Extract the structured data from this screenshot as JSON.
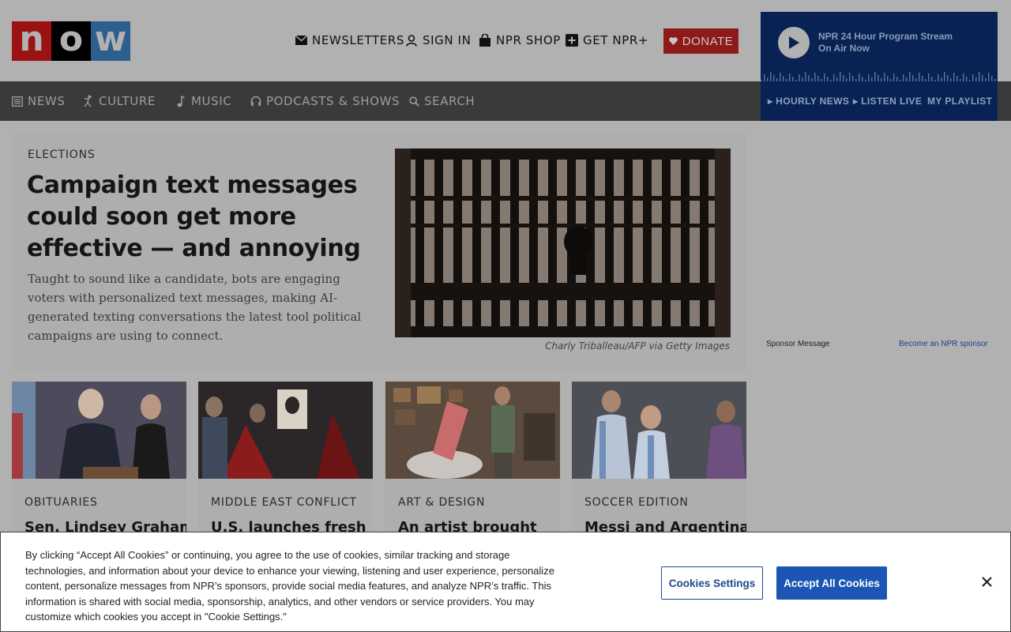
{
  "logo": {
    "letters": [
      "n",
      "o",
      "w"
    ]
  },
  "utility": {
    "newsletters": "NEWSLETTERS",
    "sign_in": "SIGN IN",
    "shop": "NPR SHOP",
    "plus": "GET NPR+"
  },
  "donate": "DONATE",
  "player": {
    "title": "NPR 24 Hour Program Stream",
    "subtitle": "On Air Now",
    "hourly": "▸ HOURLY NEWS",
    "live": "▸ LISTEN LIVE",
    "playlist": "MY PLAYLIST"
  },
  "nav": {
    "news": "NEWS",
    "culture": "CULTURE",
    "music": "MUSIC",
    "podcasts": "PODCASTS & SHOWS",
    "search": "SEARCH"
  },
  "hero": {
    "kicker": "ELECTIONS",
    "headline": "Campaign text messages could soon get more effective — and annoying",
    "teaser": "Taught to sound like a candidate, bots are engaging voters with personalized text messages, making AI-generated texting conversations the latest tool political campaigns are using to connect.",
    "credit": "Charly Triballeau/AFP via Getty Images"
  },
  "ad": {
    "sponsor": "Sponsor Message",
    "become": "Become an NPR sponsor"
  },
  "cards": [
    {
      "kicker": "OBITUARIES",
      "headline": "Sen. Lindsey Graham"
    },
    {
      "kicker": "MIDDLE EAST CONFLICT",
      "headline": "U.S. launches fresh"
    },
    {
      "kicker": "ART & DESIGN",
      "headline": "An artist brought"
    },
    {
      "kicker": "SOCCER EDITION",
      "headline": "Messi and Argentina"
    }
  ],
  "cookie": {
    "text": "By clicking “Accept All Cookies” or continuing, you agree to the use of cookies, similar tracking and storage technologies, and information about your device to enhance your viewing, listening and user experience, personalize content, personalize messages from NPR’s sponsors, provide social media features, and analyze NPR’s traffic. This information is shared with social media, sponsorship, analytics, and other vendors or service providers. You may customize which cookies you accept in \"Cookie Settings.\"",
    "settings": "Cookies Settings",
    "accept": "Accept All Cookies"
  }
}
